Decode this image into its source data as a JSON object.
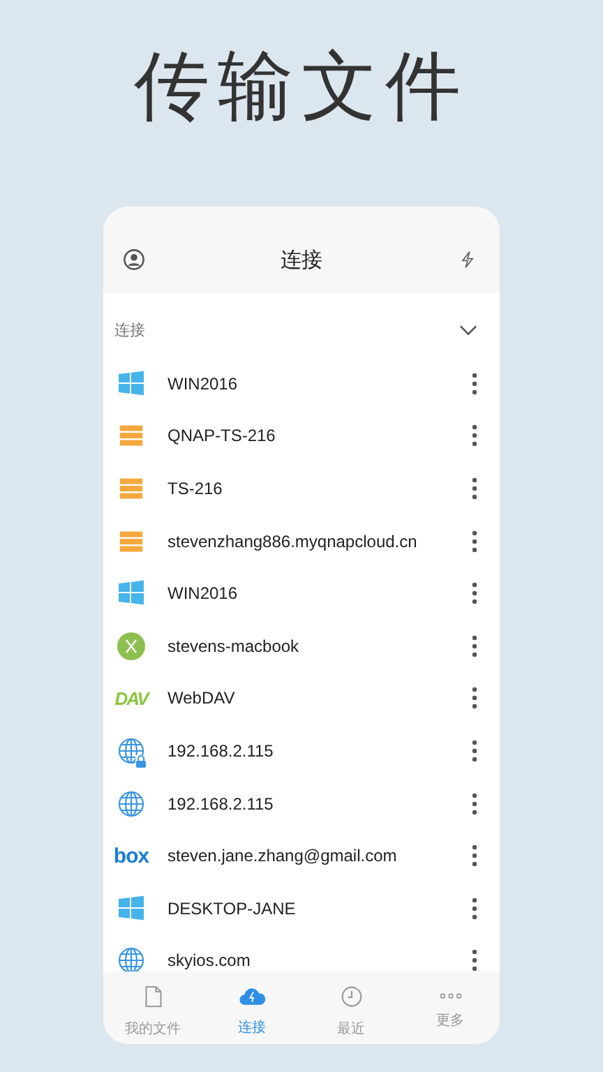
{
  "headline": "传输文件",
  "header": {
    "title": "连接"
  },
  "section": {
    "label": "连接",
    "expanded": true
  },
  "connections": [
    {
      "kind": "windows",
      "name": "WIN2016",
      "locked": false
    },
    {
      "kind": "nas",
      "name": "QNAP-TS-216",
      "locked": false
    },
    {
      "kind": "nas",
      "name": "TS-216",
      "locked": false
    },
    {
      "kind": "nas",
      "name": "stevenzhang886.myqnapcloud.cn",
      "locked": false
    },
    {
      "kind": "windows",
      "name": "WIN2016",
      "locked": false
    },
    {
      "kind": "mac",
      "name": "stevens-macbook",
      "locked": false
    },
    {
      "kind": "logo",
      "logo": "DAV",
      "name": "WebDAV",
      "locked": false
    },
    {
      "kind": "globe",
      "name": "192.168.2.115",
      "locked": true
    },
    {
      "kind": "globe",
      "name": "192.168.2.115",
      "locked": false
    },
    {
      "kind": "box",
      "logo": "box",
      "name": "steven.jane.zhang@gmail.com",
      "locked": false
    },
    {
      "kind": "windows",
      "name": "DESKTOP-JANE",
      "locked": false
    },
    {
      "kind": "globe",
      "name": "skyios.com",
      "locked": false
    }
  ],
  "tabs": [
    {
      "kind": "file",
      "label": "我的文件",
      "selected": false
    },
    {
      "kind": "cloud",
      "label": "连接",
      "selected": true
    },
    {
      "kind": "clock",
      "label": "最近",
      "selected": false
    },
    {
      "kind": "more",
      "label": "更多",
      "selected": false
    }
  ]
}
